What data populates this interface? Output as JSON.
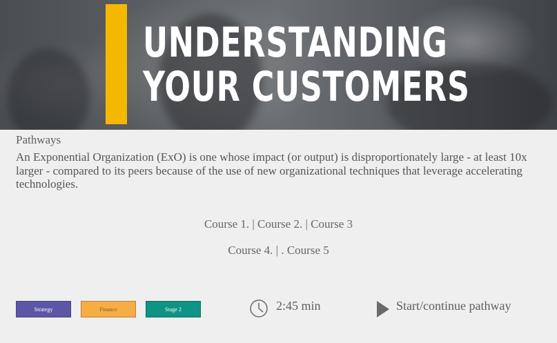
{
  "hero": {
    "title_line1": "UNDERSTANDING",
    "title_line2": "YOUR CUSTOMERS",
    "accent_color": "#f5b800"
  },
  "section_label": "Pathways",
  "description": "An Exponential Organization (ExO) is one whose impact (or output) is disproportionately large - at least 10x larger - compared to its peers because of the use of new organizational techniques that leverage accelerating technologies.",
  "courses": {
    "row1": [
      "Course 1.",
      "Course 2.",
      "Course 3"
    ],
    "row2": [
      "Course 4.",
      ". Course 5"
    ],
    "separator": " | "
  },
  "tags": [
    {
      "label": "Strategy",
      "color": "#5d56a6",
      "text_color": "#ffffff"
    },
    {
      "label": "Finance",
      "color": "#f7ad45",
      "text_color": "#7a5a2a"
    },
    {
      "label": "Stage 2",
      "color": "#0e9384",
      "text_color": "#ffffff"
    }
  ],
  "duration": "2:45 min",
  "start_label": "Start/continue pathway",
  "icons": {
    "clock": "clock-icon",
    "play": "play-icon"
  }
}
